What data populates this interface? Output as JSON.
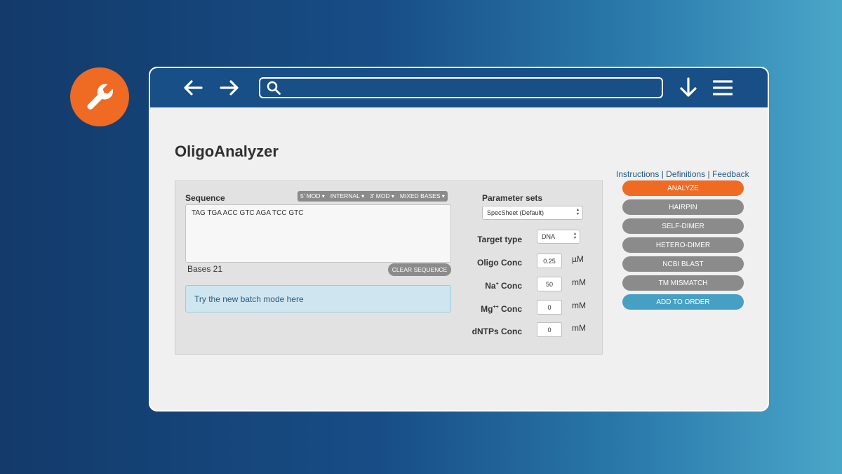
{
  "badge": {
    "icon": "wrench-icon"
  },
  "browser": {
    "back_icon": "arrow-left-icon",
    "forward_icon": "arrow-right-icon",
    "search_icon": "search-icon",
    "address_value": "",
    "download_icon": "download-icon",
    "menu_icon": "hamburger-menu-icon"
  },
  "page": {
    "title": "OligoAnalyzer"
  },
  "sequence": {
    "label": "Sequence",
    "mod_buttons": [
      "5' MOD",
      "INTERNAL",
      "3' MOD",
      "MIXED BASES"
    ],
    "value": "TAG TGA ACC GTC AGA TCC GTC",
    "bases_text": "Bases 21",
    "clear_label": "CLEAR SEQUENCE",
    "batch_prefix": "Try the new batch mode ",
    "batch_link": "here"
  },
  "parameters": {
    "title": "Parameter sets",
    "parameter_set_value": "SpecSheet (Default)",
    "target_type_label": "Target type",
    "target_type_value": "DNA",
    "oligo_conc_label": "Oligo Conc",
    "oligo_conc_value": "0.25",
    "oligo_conc_unit": "µM",
    "na_conc_label_prefix": "Na",
    "na_conc_label_sup": "+",
    "na_conc_label_suffix": " Conc",
    "na_conc_value": "50",
    "na_conc_unit": "mM",
    "mg_conc_label_prefix": "Mg",
    "mg_conc_label_sup": "++",
    "mg_conc_label_suffix": " Conc",
    "mg_conc_value": "0",
    "mg_conc_unit": "mM",
    "dntps_conc_label": "dNTPs Conc",
    "dntps_conc_value": "0",
    "dntps_conc_unit": "mM"
  },
  "links": {
    "instructions": "Instructions",
    "definitions": "Definitions",
    "feedback": "Feedback",
    "separator": " | "
  },
  "actions": {
    "analyze": "ANALYZE",
    "hairpin": "HAIRPIN",
    "self_dimer": "SELF-DIMER",
    "hetero_dimer": "HETERO-DIMER",
    "ncbi_blast": "NCBI BLAST",
    "tm_mismatch": "TM MISMATCH",
    "add_to_order": "ADD TO ORDER"
  },
  "colors": {
    "accent_orange": "#ef6a22",
    "header_blue": "#184f86",
    "button_gray": "#8b8b8b",
    "button_teal": "#45a0c4"
  }
}
